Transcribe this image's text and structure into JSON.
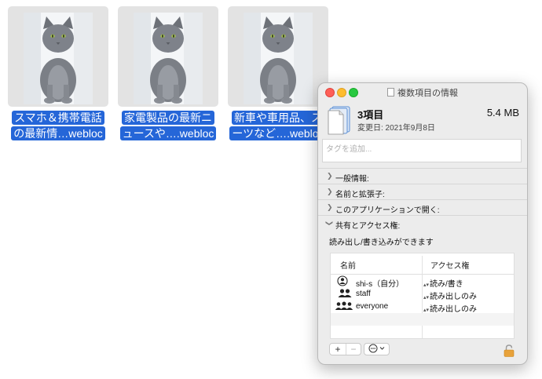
{
  "desktop": {
    "files": [
      {
        "label_line1": "スマホ＆携帯電話",
        "label_line2": "の最新情…webloc"
      },
      {
        "label_line1": "家電製品の最新ニ",
        "label_line2": "ュースや….webloc"
      },
      {
        "label_line1": "新車や車用品、ス",
        "label_line2": "ーツなど….webloc"
      }
    ]
  },
  "info_window": {
    "title": "複数項目の情報",
    "summary": {
      "title": "3項目",
      "size": "5.4 MB",
      "modified": "変更日: 2021年9月8日"
    },
    "tags_placeholder": "タグを追加...",
    "sections": [
      {
        "label": "一般情報:",
        "expanded": false
      },
      {
        "label": "名前と拡張子:",
        "expanded": false
      },
      {
        "label": "このアプリケーションで開く:",
        "expanded": false
      },
      {
        "label": "共有とアクセス権:",
        "expanded": true
      }
    ],
    "sharing": {
      "status": "読み出し/書き込みができます",
      "columns": {
        "name": "名前",
        "privilege": "アクセス権"
      },
      "rows": [
        {
          "name": "shi-s（自分）",
          "privilege": "読み/書き",
          "icon": "single-user-icon"
        },
        {
          "name": "staff",
          "privilege": "読み出しのみ",
          "icon": "group-icon"
        },
        {
          "name": "everyone",
          "privilege": "読み出しのみ",
          "icon": "everyone-icon"
        }
      ]
    },
    "buttons": {
      "add": "+",
      "remove": "−"
    }
  },
  "colors": {
    "selection": "#2566d8",
    "window_bg": "#ececec",
    "close": "#fe5f57",
    "minimize": "#febc2e",
    "maximize": "#28c840"
  }
}
